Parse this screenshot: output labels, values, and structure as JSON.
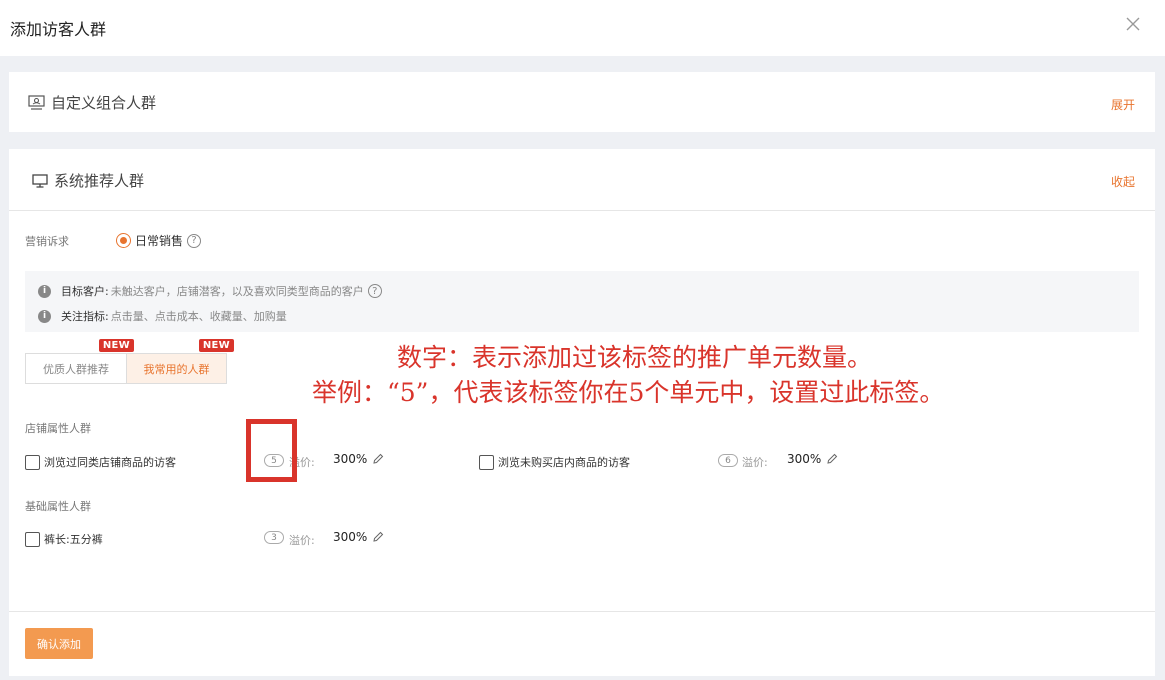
{
  "dialog": {
    "title": "添加访客人群"
  },
  "custom_group": {
    "title": "自定义组合人群",
    "action": "展开"
  },
  "system_group": {
    "title": "系统推荐人群",
    "action": "收起"
  },
  "marketing": {
    "label": "营销诉求",
    "option": "日常销售",
    "help": "?"
  },
  "info": {
    "target_key": "目标客户:",
    "target_value": "未触达客户，店铺潜客，以及喜欢同类型商品的客户",
    "metric_key": "关注指标:",
    "metric_value": "点击量、点击成本、收藏量、加购量",
    "dot": "i"
  },
  "tabs": [
    {
      "label": "优质人群推荐",
      "badge": "NEW"
    },
    {
      "label": "我常用的人群",
      "badge": "NEW"
    }
  ],
  "sections": {
    "store_attr": "店铺属性人群",
    "basic_attr": "基础属性人群"
  },
  "items": [
    {
      "label": "浏览过同类店铺商品的访客",
      "count": "5",
      "premium_label": "溢价:",
      "premium_value": "300%"
    },
    {
      "label": "浏览未购买店内商品的访客",
      "count": "6",
      "premium_label": "溢价:",
      "premium_value": "300%"
    },
    {
      "label": "裤长:五分裤",
      "count": "3",
      "premium_label": "溢价:",
      "premium_value": "300%"
    }
  ],
  "confirm_button": "确认添加",
  "annotation": {
    "line1": "数字：表示添加过该标签的推广单元数量。",
    "line2": "举例：“5”，代表该标签你在5个单元中，设置过此标签。"
  },
  "colors": {
    "accent": "#e8742e",
    "button": "#f39a50",
    "badge": "#d9342b",
    "annotation": "#d9342b"
  }
}
